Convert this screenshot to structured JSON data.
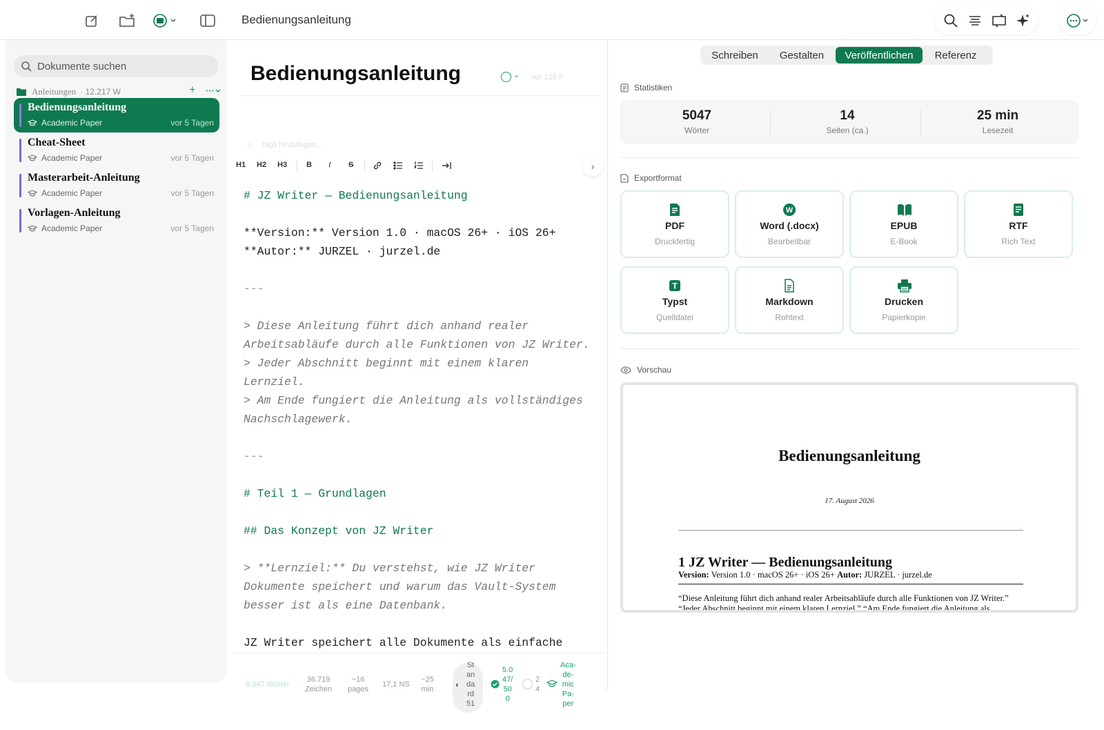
{
  "topbar": {
    "title": "Bedienungsanleitung",
    "icons": [
      "compose-icon",
      "new-folder-icon",
      "vault-icon",
      "sidebar-toggle-icon",
      "search-icon",
      "outline-icon",
      "sync-icon",
      "sparkle-icon",
      "more-icon"
    ]
  },
  "sidebar": {
    "search_placeholder": "Dokumente suchen",
    "folder": {
      "name": "Anleitungen",
      "count": "· 12.217 W",
      "add": "+",
      "more": "···"
    },
    "documents": [
      {
        "title": "Bedienungsanleitung",
        "category": "Academic Paper",
        "time": "vor 5 Tagen",
        "active": true
      },
      {
        "title": "Cheat-Sheet",
        "category": "Academic Paper",
        "time": "vor 5 Tagen",
        "active": false
      },
      {
        "title": "Masterarbeit-Anleitung",
        "category": "Academic Paper",
        "time": "vor 5 Tagen",
        "active": false
      },
      {
        "title": "Vorlagen-Anleitung",
        "category": "Academic Paper",
        "time": "vor 5 Tagen",
        "active": false
      }
    ]
  },
  "editor": {
    "title": "Bedienungsanleitung",
    "age": "vor 126 h",
    "tags_placeholder": "Tags hinzufügen...",
    "toolbar": {
      "h1": "H1",
      "h2": "H2",
      "h3": "H3",
      "bold": "B",
      "italic": "I",
      "strike": "S"
    },
    "lines": [
      "# JZ Writer — Bedienungsanleitung",
      "",
      "**Version:** Version 1.0 · macOS 26+ · iOS 26+",
      "**Autor:** JURZEL · jurzel.de",
      "",
      "---",
      "",
      "> Diese Anleitung führt dich anhand realer",
      "Arbeitsabläufe durch alle Funktionen von JZ Writer.",
      "> Jeder Abschnitt beginnt mit einem klaren",
      "Lernziel.",
      "> Am Ende fungiert die Anleitung als vollständiges",
      "Nachschlagewerk.",
      "",
      "---",
      "",
      "# Teil 1 — Grundlagen",
      "",
      "## Das Konzept von JZ Writer",
      "",
      "> **Lernziel:** Du verstehst, wie JZ Writer",
      "Dokumente speichert und warum das Vault-System",
      "besser ist als eine Datenbank.",
      "",
      "JZ Writer speichert alle Dokumente als einfache"
    ],
    "footer": {
      "words": "5.047 Wörter",
      "chars_value": "36.719",
      "chars_label": "Zeichen",
      "pages_value": "~16",
      "pages_label": "pages",
      "ns": "17,1 NS",
      "time_value": "~25",
      "time_label": "min",
      "style_lines": [
        "St",
        "an",
        "da",
        "rd",
        "51"
      ],
      "goal_lines": [
        "5.0",
        "47/",
        "50",
        "0"
      ],
      "progress_lines": [
        "2",
        "4"
      ],
      "template_lines": [
        "Aca-",
        "de-",
        "mic",
        "Pa-",
        "per"
      ]
    }
  },
  "panel": {
    "tabs": [
      "Schreiben",
      "Gestalten",
      "Veröffentlichen",
      "Referenz"
    ],
    "active_tab": 2,
    "stats_title": "Statistiken",
    "stats": [
      {
        "value": "5047",
        "label": "Wörter"
      },
      {
        "value": "14",
        "label": "Seiten (ca.)"
      },
      {
        "value": "25 min",
        "label": "Lesezeit"
      }
    ],
    "export_title": "Exportformat",
    "formats": [
      {
        "name": "PDF",
        "sub": "Druckfertig",
        "icon": "pdf-icon"
      },
      {
        "name": "Word (.docx)",
        "sub": "Bearbeitbar",
        "icon": "word-icon"
      },
      {
        "name": "EPUB",
        "sub": "E-Book",
        "icon": "book-icon"
      },
      {
        "name": "RTF",
        "sub": "Rich Text",
        "icon": "rtf-icon"
      },
      {
        "name": "Typst",
        "sub": "Quelldatei",
        "icon": "typst-icon"
      },
      {
        "name": "Markdown",
        "sub": "Rohtext",
        "icon": "markdown-icon"
      },
      {
        "name": "Drucken",
        "sub": "Papierkopie",
        "icon": "printer-icon"
      }
    ],
    "preview_title": "Vorschau",
    "preview": {
      "title": "Bedienungsanleitung",
      "date": "17. August 2026",
      "heading": "1 JZ Writer — Bedienungsanleitung",
      "meta_version_label": "Version:",
      "meta_version": " Version 1.0 · macOS 26+ · iOS 26+ ",
      "meta_author_label": "Autor:",
      "meta_author": " JURZEL · jurzel.de",
      "body_1": "“Diese Anleitung führt dich anhand realer Arbeitsabläufe durch alle Funktionen von JZ Writer.”",
      "body_2": "“Jeder Abschnitt beginnt mit einem klaren Lernziel.” “Am Ende fungiert die Anleitung als"
    }
  },
  "colors": {
    "accent": "#0f7a4f",
    "accent_light": "#19a06a",
    "doc_bar": "#7a66d6"
  }
}
